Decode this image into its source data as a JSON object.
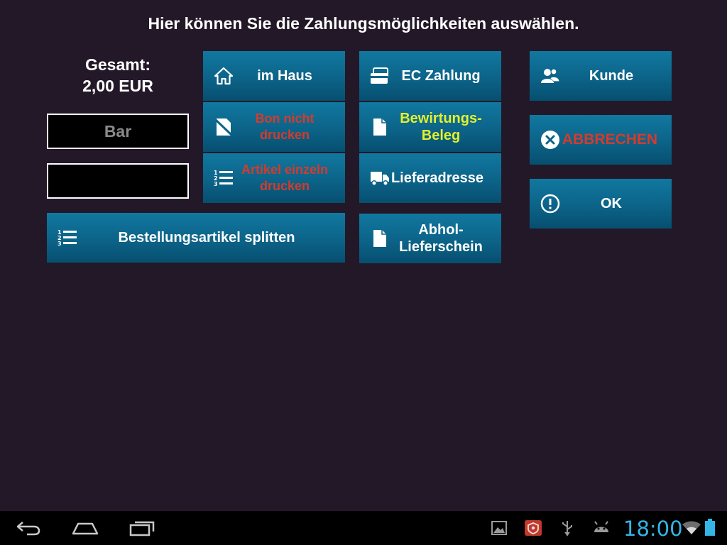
{
  "header": {
    "title": "Hier können Sie die Zahlungsmöglichkeiten auswählen."
  },
  "total": {
    "label": "Gesamt:",
    "amount": "2,00 EUR"
  },
  "fields": {
    "payment_value": "Bar",
    "second_value": ""
  },
  "buttons": {
    "im_haus": "im Haus",
    "ec_zahlung": "EC Zahlung",
    "kunde": "Kunde",
    "bon_nicht_drucken": "Bon nicht drucken",
    "bewirtungs_beleg": "Bewirtungs- Beleg",
    "abbrechen": "ABBRECHEN",
    "artikel_einzeln_drucken": "Artikel einzeln drucken",
    "lieferadresse": "Lieferadresse",
    "ok": "OK",
    "bestellungsartikel_splitten": "Bestellungsartikel splitten",
    "abhol_lieferschein": "Abhol- Lieferschein"
  },
  "statusbar": {
    "time": "18:00"
  },
  "colors": {
    "background": "#231828",
    "button": "#0c6388",
    "warning_text": "#d53b2b",
    "highlight_text": "#e4f02a",
    "clock": "#33b5e5"
  },
  "icons": {
    "im_haus": "home-icon",
    "ec_zahlung": "card-icon",
    "kunde": "users-icon",
    "bon_nicht_drucken": "no-print-icon",
    "bewirtungs_beleg": "document-icon",
    "abbrechen": "close-circle-icon",
    "artikel_einzeln_drucken": "numbered-list-icon",
    "lieferadresse": "truck-icon",
    "ok": "exclamation-circle-icon",
    "bestellungsartikel_splitten": "numbered-list-icon",
    "abhol_lieferschein": "document-icon"
  }
}
